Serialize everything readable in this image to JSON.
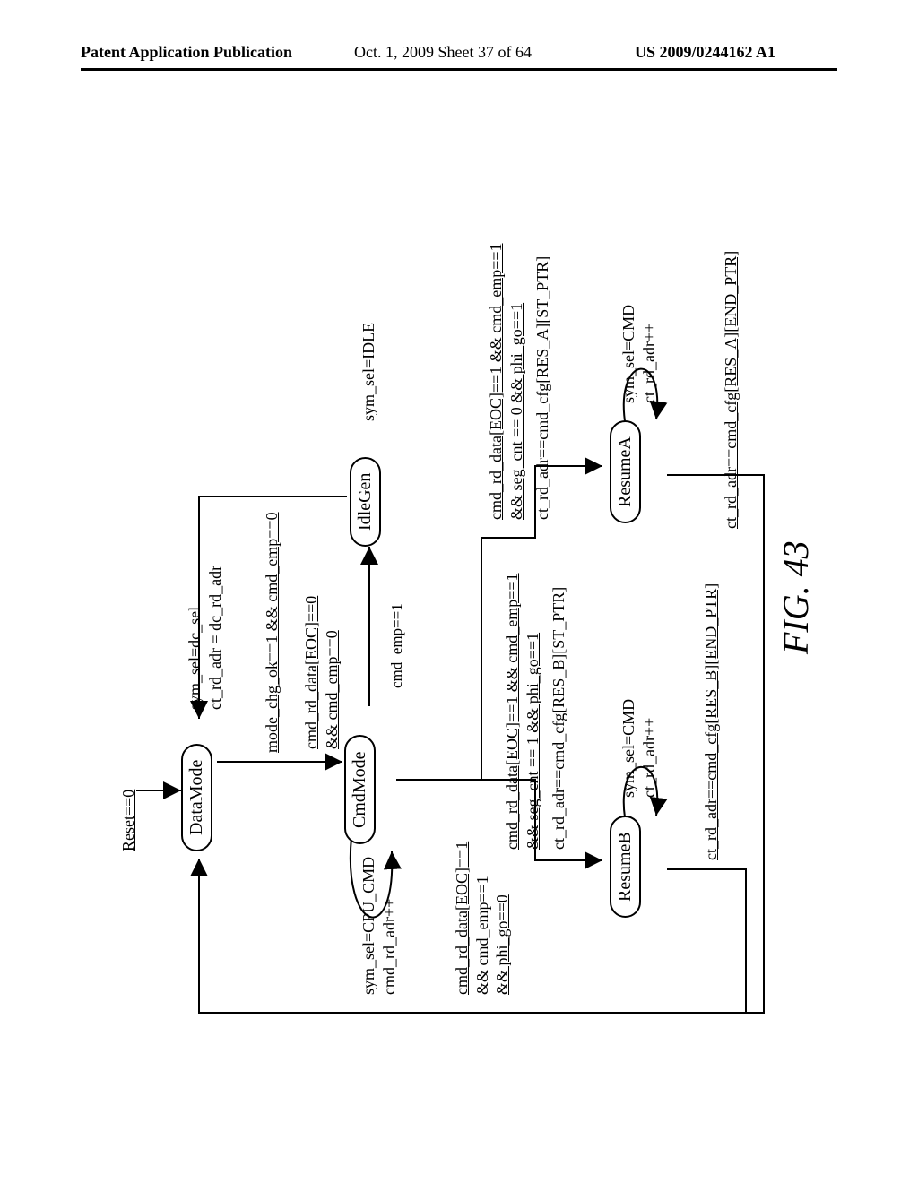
{
  "header": {
    "left": "Patent Application Publication",
    "mid": "Oct. 1, 2009   Sheet 37 of 64",
    "right": "US 2009/0244162 A1"
  },
  "figure": {
    "label": "FIG. 43"
  },
  "states": {
    "dataMode": "DataMode",
    "cmdMode": "CmdMode",
    "idleGen": "IdleGen",
    "resumeA": "ResumeA",
    "resumeB": "ResumeB"
  },
  "labels": {
    "reset": "Reset==0",
    "dataMode_out": {
      "l1": "sym_sel=dc_sel",
      "l2": "ct_rd_adr = dc_rd_adr"
    },
    "data_to_cmd_cond": "mode_chg_ok==1 && cmd_emp==0",
    "cmd_to_data_cond": {
      "l1": "cmd_rd_data[EOC]==0",
      "l2": "&& cmd_emp==0"
    },
    "cmd_to_idle_cond": "cmd_emp==1",
    "idle_out": "sym_sel=IDLE",
    "cmd_out": {
      "l1": "sym_sel=CPU_CMD",
      "l2": "cmd_rd_adr++"
    },
    "cmd_to_resume_cond": {
      "l1": "cmd_rd_data[EOC]==1",
      "l2": "&& cmd_emp==1",
      "l3": "&& phi_go==0"
    },
    "resumeB_cond1": "cmd_rd_data[EOC]==1 && cmd_emp==1",
    "resumeB_cond2": "&& seg_cnt == 1 && phi_go==1",
    "resumeB_assign": "ct_rd_adr==cmd_cfg[RES_B][ST_PTR]",
    "resumeB_out": {
      "l1": "sym_sel=CMD",
      "l2": "ct_rd_adr++"
    },
    "resumeB_end": "ct_rd_adr==cmd_cfg[RES_B][END_PTR]",
    "resumeA_cond1": "cmd_rd_data[EOC]==1 && cmd_emp==1",
    "resumeA_cond2": "&& seg_cnt == 0 && phi_go==1",
    "resumeA_assign": "ct_rd_adr==cmd_cfg[RES_A][ST_PTR]",
    "resumeA_out": {
      "l1": "sym_sel=CMD",
      "l2": "ct_rd_adr++"
    },
    "resumeA_end": "ct_rd_adr==cmd_cfg[RES_A][END_PTR]"
  }
}
